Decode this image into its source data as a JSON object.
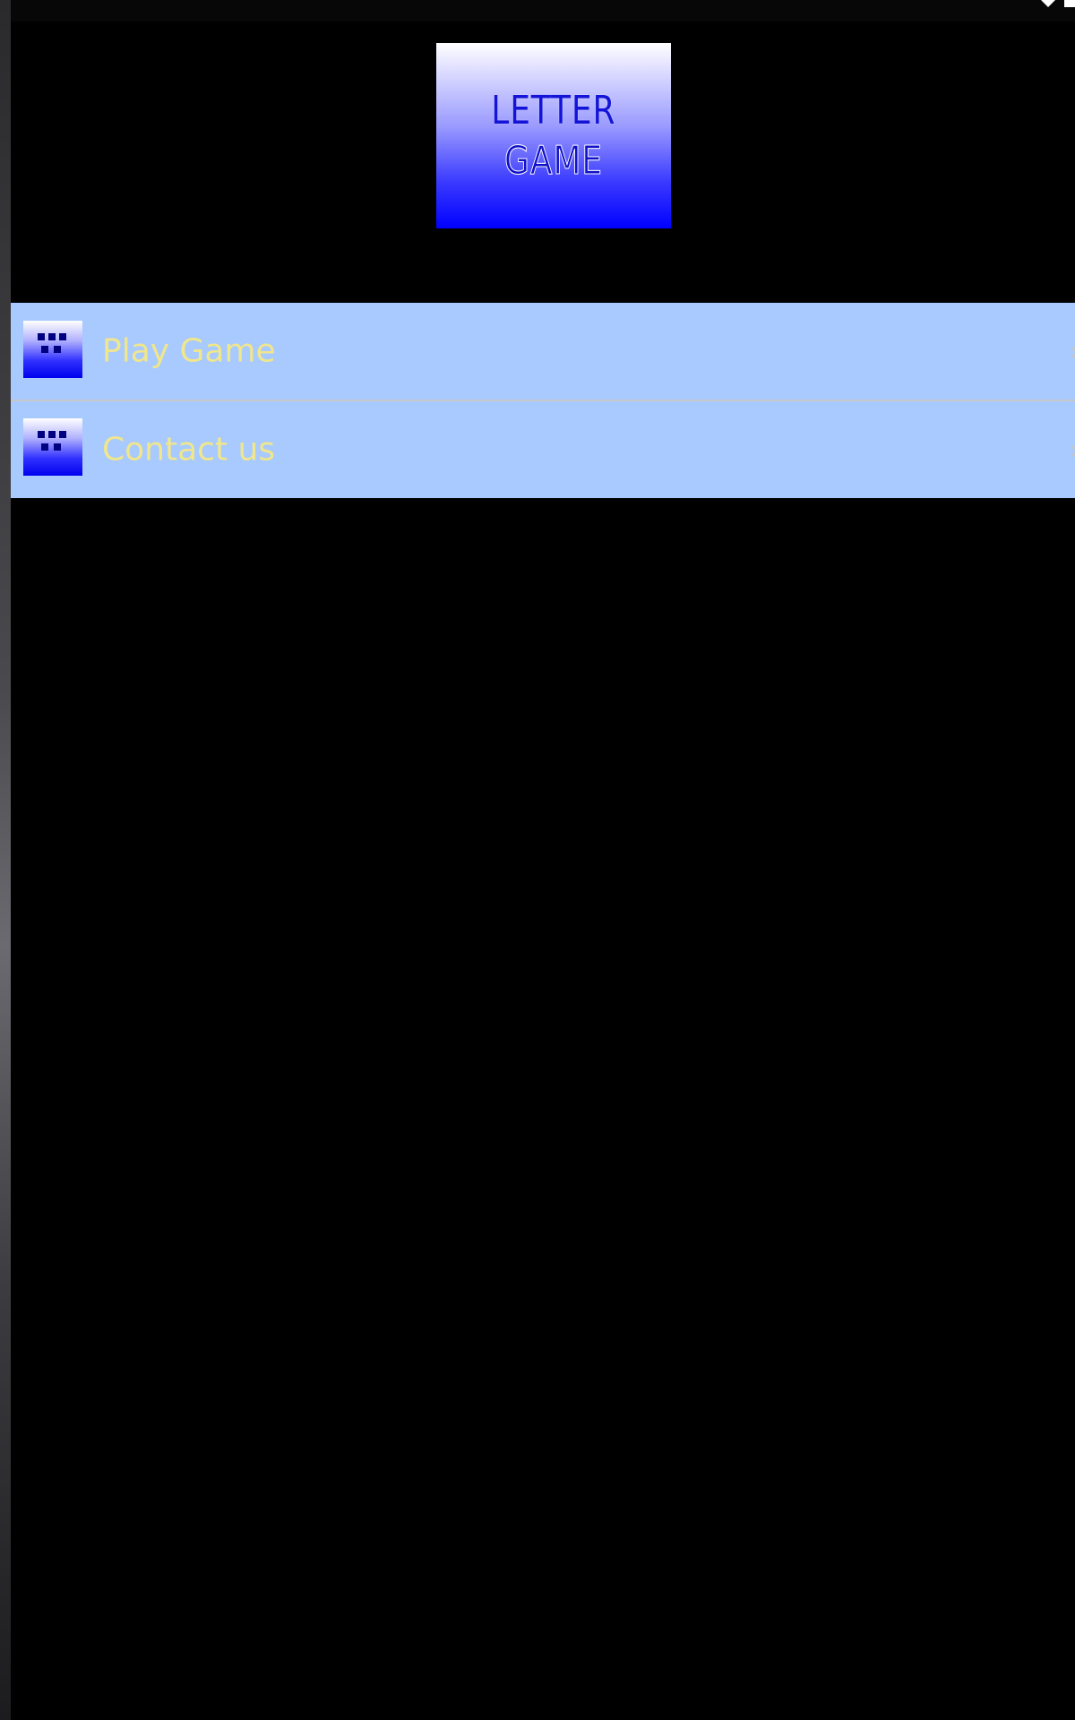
{
  "app": {
    "logo": {
      "line1": "LETTER",
      "line2": "GAME"
    }
  },
  "menu": {
    "items": [
      {
        "label": "Play Game",
        "icon": "letter-game-icon",
        "chevron": "›"
      },
      {
        "label": "Contact us",
        "icon": "letter-game-icon",
        "chevron": "›"
      }
    ]
  },
  "colors": {
    "background": "#000000",
    "menu_background": "#a8caff",
    "menu_text": "#f0e68c",
    "logo_blue": "#0000ff",
    "divider": "#c8c8c8"
  },
  "icons": {
    "status": "wifi-signal-icon",
    "chevron": "chevron-right-icon"
  }
}
